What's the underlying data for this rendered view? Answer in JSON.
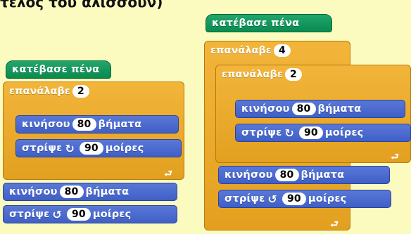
{
  "top_text": "τελος του αλισσουν)",
  "block_labels": {
    "pen_down": "κατέβασε πένα",
    "repeat": "επανάλαβε",
    "move": "κινήσου",
    "steps": "βήματα",
    "turn": "στρίψε",
    "degrees": "μοίρες"
  },
  "icons": {
    "turn_right": "↻",
    "turn_left": "↺",
    "loop_arrow": "⮐"
  },
  "left_script": {
    "repeat_count": "2",
    "inner_move_steps": "80",
    "inner_turn_degrees": "90",
    "after_move_steps": "80",
    "after_turn_degrees": "90"
  },
  "right_script": {
    "outer_repeat_count": "4",
    "inner_repeat_count": "2",
    "inner_move_steps": "80",
    "inner_turn_degrees": "90",
    "after_move_steps": "80",
    "after_turn_degrees": "90"
  },
  "colors": {
    "background": "#fcfbbf",
    "pen_block": "#0e8f55",
    "control_block": "#e8a926",
    "motion_block": "#4a6cd4"
  }
}
